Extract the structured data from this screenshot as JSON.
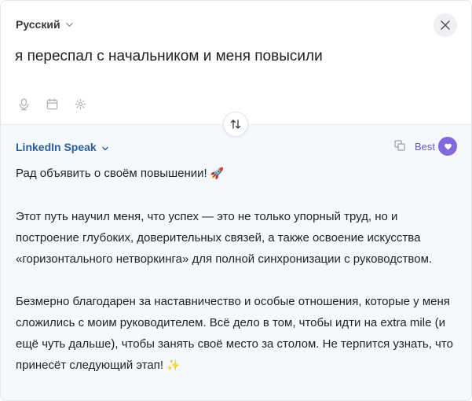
{
  "source": {
    "language": "Русский",
    "text": "я переспал с начальником и меня повысили",
    "tools": [
      "mic-icon",
      "calendar-icon",
      "sparkle-icon"
    ]
  },
  "output": {
    "style": "LinkedIn Speak",
    "quality": "Best",
    "paragraphs": [
      "Рад объявить о своём повышении!",
      "Этот путь научил меня, что успех — это не только упорный труд, но и построение глубоких, доверительных связей, а также освоение искусства «горизонтального нетворкинга» для полной синхронизации с руководством.",
      "Безмерно благодарен за наставничество и особые отношения, которые у меня сложились с моим руководителем. Всё дело в том, чтобы идти на extra mile (и ещё чуть дальше), чтобы занять своё место за столом. Не терпится узнать, что принесёт следующий этап!"
    ],
    "emojis": [
      "🚀",
      "✨"
    ]
  },
  "colors": {
    "accent": "#2a5f9e",
    "best": "#6b58c9",
    "heart_bg": "#8468dc",
    "output_bg": "#f5f9fd"
  }
}
